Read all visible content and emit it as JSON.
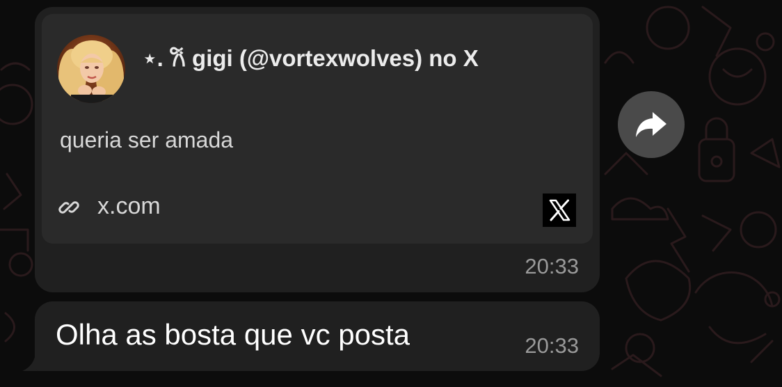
{
  "link_message": {
    "preview": {
      "title": "⋆. 𐙚 gigi (@vortexwolves) no X",
      "description": "queria ser amada",
      "domain": "x.com",
      "avatar_icon": "profile-photo",
      "site_icon": "x-logo-icon"
    },
    "time": "20:33"
  },
  "text_message": {
    "text": "Olha as bosta que vc posta",
    "time": "20:33"
  },
  "forward_button": {
    "icon": "forward-arrow-icon"
  },
  "colors": {
    "background": "#0c0c0c",
    "bubble": "#202020",
    "preview_card": "#2a2a2a",
    "timestamp": "#9a9a9a",
    "forward_button": "#4a4a4a"
  }
}
